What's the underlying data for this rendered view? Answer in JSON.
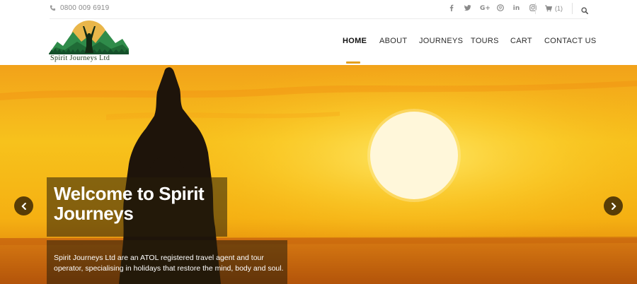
{
  "topbar": {
    "phone": "0800 009 6919",
    "socials": [
      "facebook-icon",
      "twitter-icon",
      "google-plus-icon",
      "pinterest-icon",
      "linkedin-icon",
      "instagram-icon"
    ],
    "cart_count": "(1)"
  },
  "logo": {
    "text": "Spirit Journeys Ltd"
  },
  "nav": {
    "items": [
      {
        "label": "HOME",
        "active": true
      },
      {
        "label": "ABOUT"
      },
      {
        "label": "JOURNEYS"
      },
      {
        "label": "TOURS"
      },
      {
        "label": "CART"
      },
      {
        "label": "CONTACT US"
      }
    ]
  },
  "hero": {
    "title": "Welcome to Spirit Journeys",
    "description": "Spirit Journeys Ltd are an ATOL registered travel agent and tour operator, specialising in holidays that restore the mind, body and soul."
  },
  "colors": {
    "accent": "#e3a020",
    "nav_text": "#2b2b2b",
    "muted": "#8a8a8a"
  }
}
